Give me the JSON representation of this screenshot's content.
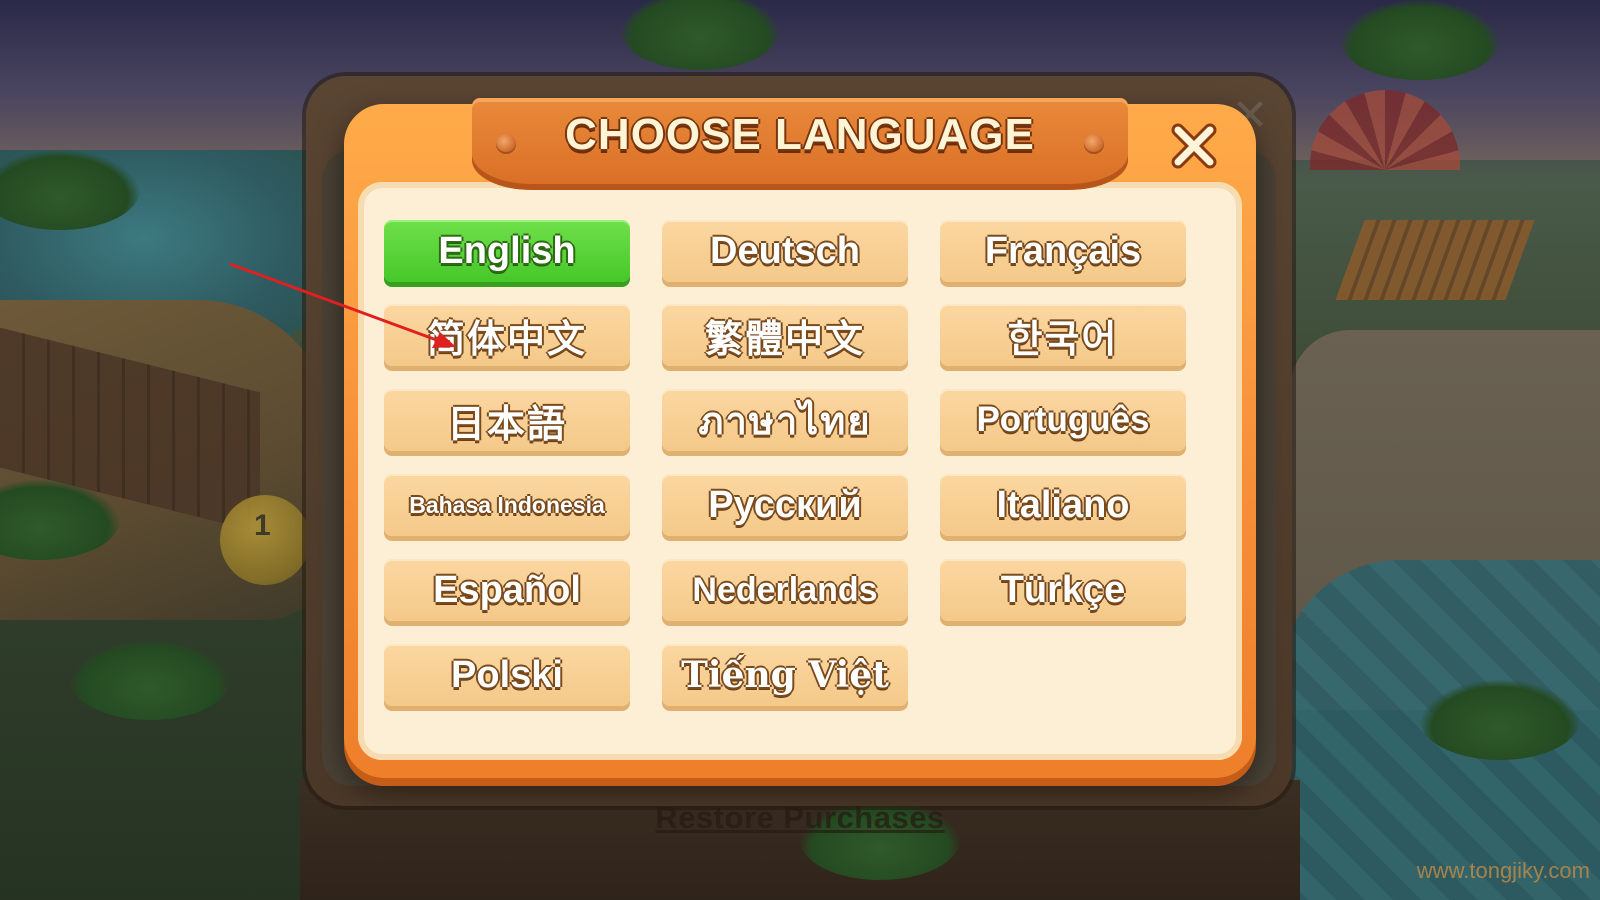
{
  "dialog": {
    "title": "CHOOSE LANGUAGE",
    "close_icon": "close-x-icon",
    "accent_color": "#f7923a",
    "selected_color": "#47c72a"
  },
  "languages": [
    {
      "label": "English",
      "selected": true
    },
    {
      "label": "Deutsch",
      "selected": false
    },
    {
      "label": "Français",
      "selected": false
    },
    {
      "label": "简体中文",
      "selected": false
    },
    {
      "label": "繁體中文",
      "selected": false
    },
    {
      "label": "한국어",
      "selected": false
    },
    {
      "label": "日本語",
      "selected": false
    },
    {
      "label": "ภาษาไทย",
      "selected": false
    },
    {
      "label": "Português",
      "selected": false
    },
    {
      "label": "Bahasa Indonesia",
      "selected": false
    },
    {
      "label": "Русский",
      "selected": false
    },
    {
      "label": "Italiano",
      "selected": false
    },
    {
      "label": "Español",
      "selected": false
    },
    {
      "label": "Nederlands",
      "selected": false
    },
    {
      "label": "Türkçe",
      "selected": false
    },
    {
      "label": "Polski",
      "selected": false
    },
    {
      "label": "Tiếng Việt",
      "selected": false
    }
  ],
  "background": {
    "restore_link": "Restore Purchases",
    "level_badge": "1",
    "watermark": "www.tongjiky.com"
  },
  "annotation": {
    "arrow_color": "#e02020",
    "arrow_icon": "red-arrow-icon"
  }
}
